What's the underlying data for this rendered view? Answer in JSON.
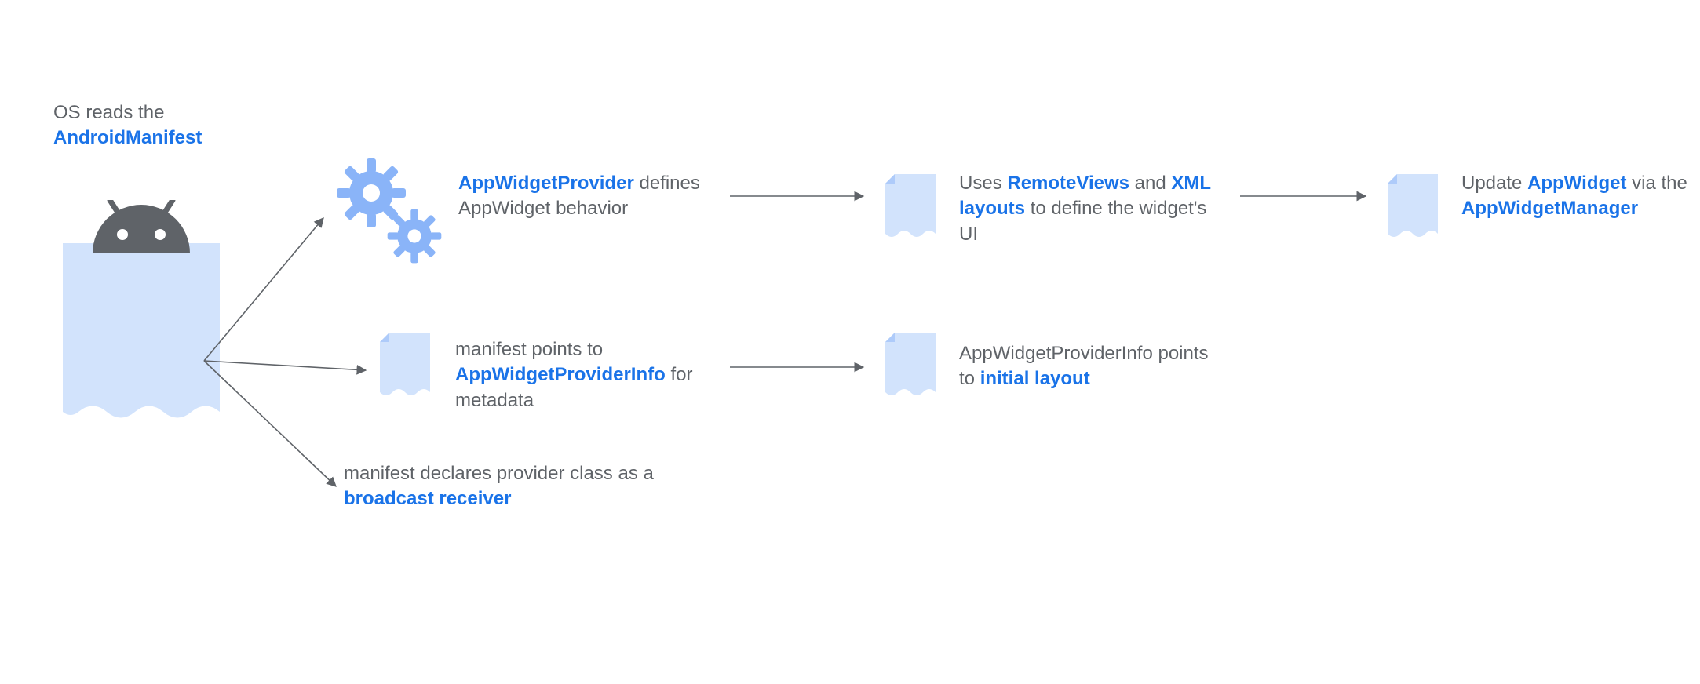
{
  "intro": {
    "line1": "OS reads the",
    "keyword": "AndroidManifest"
  },
  "nodes": {
    "provider": {
      "keyword": "AppWidgetProvider",
      "tail": "defines AppWidget behavior"
    },
    "remoteviews": {
      "pre": "Uses ",
      "k1": "RemoteViews",
      "mid": " and ",
      "k2": "XML layouts",
      "tail": " to define the widget's UI"
    },
    "update": {
      "pre": "Update ",
      "k1": "AppWidget",
      "mid": " via the ",
      "k2": "AppWidgetManager"
    },
    "providerinfo": {
      "pre": "manifest points to ",
      "k1": "AppWidgetProviderInfo",
      "tail": " for metadata"
    },
    "initiallayout": {
      "pre": "AppWidgetProviderInfo points to ",
      "k1": "initial layout"
    },
    "broadcast": {
      "pre": "manifest declares provider class as a ",
      "k1": "broadcast receiver"
    }
  },
  "icons": {
    "android": "android-icon",
    "gears": "gears-icon",
    "page": "page-icon"
  },
  "colors": {
    "blue_text": "#1a73e8",
    "grey_text": "#5f6368",
    "light_blue_fill": "#d2e3fc",
    "gear_blue": "#8ab4f8",
    "arrow": "#5f6368"
  }
}
